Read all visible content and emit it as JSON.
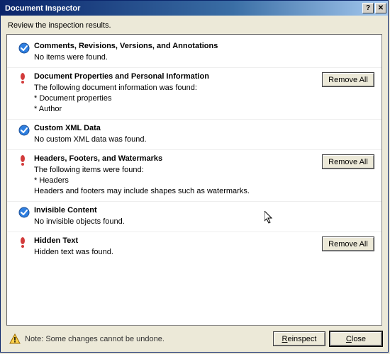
{
  "window": {
    "title": "Document Inspector",
    "help_label": "?",
    "close_label": "✕"
  },
  "subtitle": "Review the inspection results.",
  "sections": [
    {
      "status": "ok",
      "title": "Comments, Revisions, Versions, and Annotations",
      "lines": [
        "No items were found."
      ],
      "action": null
    },
    {
      "status": "warn",
      "title": "Document Properties and Personal Information",
      "lines": [
        "The following document information was found:",
        "* Document properties",
        "* Author"
      ],
      "action": "Remove All"
    },
    {
      "status": "ok",
      "title": "Custom XML Data",
      "lines": [
        "No custom XML data was found."
      ],
      "action": null
    },
    {
      "status": "warn",
      "title": "Headers, Footers, and Watermarks",
      "lines": [
        "The following items were found:",
        "* Headers",
        "Headers and footers may include shapes such as watermarks."
      ],
      "action": "Remove All"
    },
    {
      "status": "ok",
      "title": "Invisible Content",
      "lines": [
        "No invisible objects found."
      ],
      "action": null
    },
    {
      "status": "warn",
      "title": "Hidden Text",
      "lines": [
        "Hidden text was found."
      ],
      "action": "Remove All"
    }
  ],
  "footer": {
    "note": "Note: Some changes cannot be undone.",
    "reinspect": "Reinspect",
    "close": "Close"
  }
}
